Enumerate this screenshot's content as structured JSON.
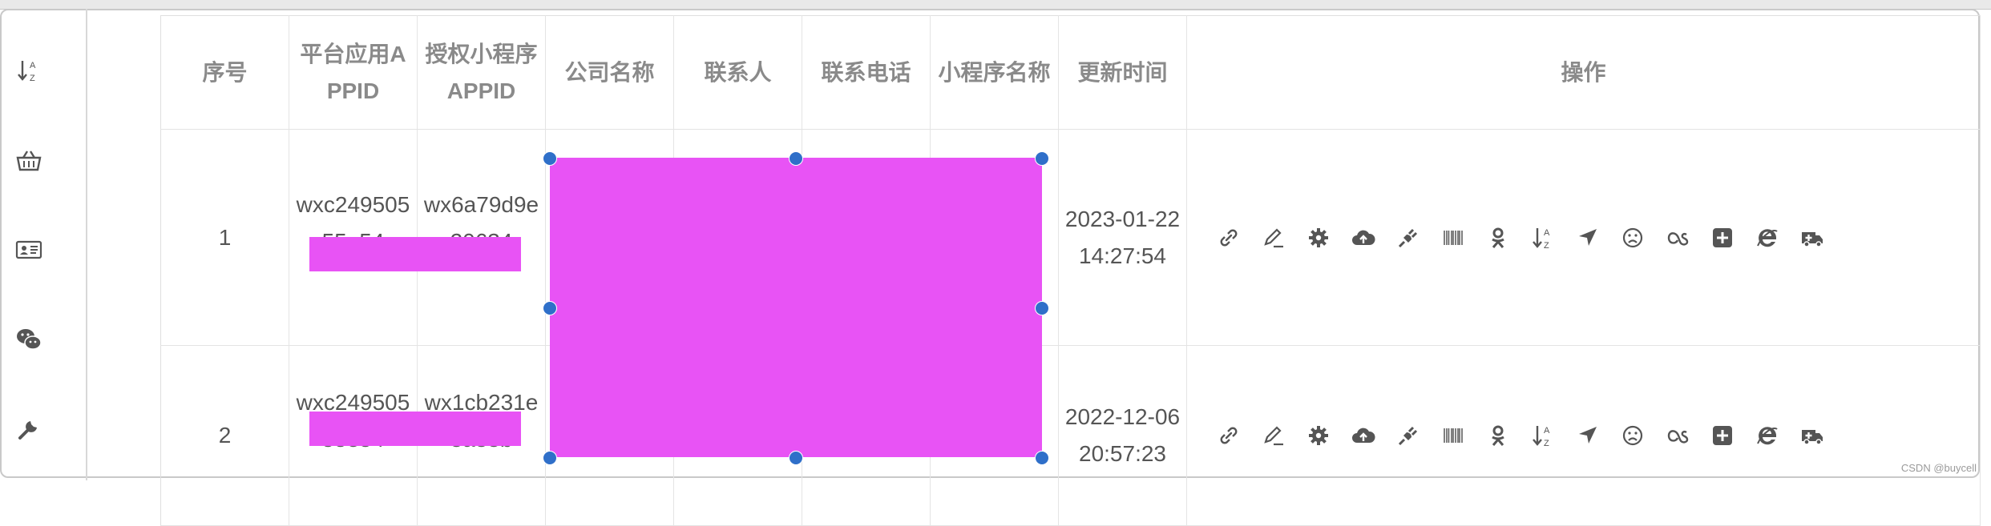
{
  "table": {
    "headers": {
      "index": "序号",
      "platform_appid": "平台应用APPID",
      "authorized_appid": "授权小程序APPID",
      "company_name": "公司名称",
      "contact": "联系人",
      "phone": "联系电话",
      "miniprogram_name": "小程序名称",
      "updated_at": "更新时间",
      "actions": "操作"
    },
    "rows": [
      {
        "index": "1",
        "platform_appid": "wxc24950555e54",
        "authorized_appid": "wx6a79d9e20634",
        "updated_at": "2023-01-22 14:27:54"
      },
      {
        "index": "2",
        "platform_appid": "wxc24950555e54",
        "authorized_appid": "wx1cb231e8a33b",
        "updated_at": "2022-12-06 20:57:23"
      }
    ]
  },
  "left_toolbar": {
    "icons": [
      "sort-alpha-icon",
      "basket-icon",
      "id-card-icon",
      "wechat-icon",
      "wrench-icon"
    ]
  },
  "action_icons": [
    "link-icon",
    "edit-icon",
    "gear-icon",
    "cloud-upload-icon",
    "plug-icon",
    "barcode-icon",
    "odnoklassniki-icon",
    "sort-alpha-icon",
    "location-arrow-icon",
    "frown-icon",
    "lastfm-icon",
    "plus-square-icon",
    "internet-explorer-icon",
    "ambulance-icon"
  ],
  "colors": {
    "redaction": "#e853f5",
    "handle": "#2f6fc9",
    "icon": "#555555",
    "header_text": "#8a8a8a"
  },
  "watermark": "CSDN @buycell"
}
